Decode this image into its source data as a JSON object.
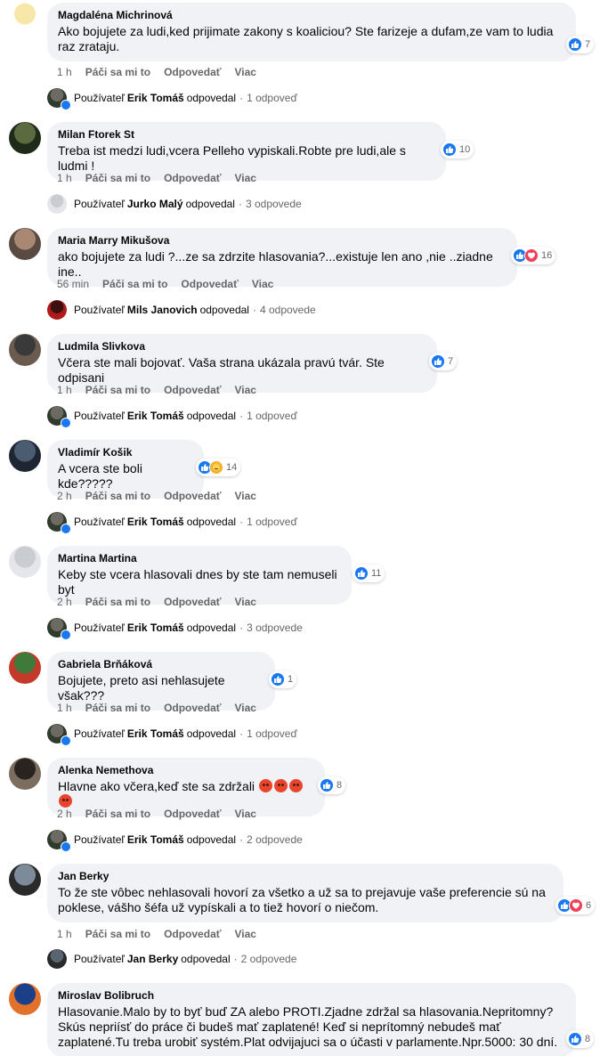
{
  "labels": {
    "like": "Páči sa mi to",
    "reply": "Odpovedať",
    "more": "Viac",
    "user_prefix": "Používateľ",
    "replied": "odpovedal"
  },
  "colors": {
    "like": "#1877f2",
    "love": "#f33e58",
    "care": "#f7b125",
    "angry": "#e8452c"
  },
  "comments": [
    {
      "author": "Magdaléna Michrinová",
      "text": "Ako bojujete za ludi,ked prijimate zakony s koaliciou? Ste farizeje a dufam,ze vam to ludia raz zrataju.",
      "time": "1 h",
      "reactions": [
        "like"
      ],
      "reaction_count": "7",
      "reply_user": "Erik Tomáš",
      "reply_count": "1 odpoveď"
    },
    {
      "author": "Milan Ftorek St",
      "text": "Treba ist medzi ludi,vcera Pelleho vypiskali.Robte pre ludi,ale s ludmi !",
      "time": "1 h",
      "reactions": [
        "like"
      ],
      "reaction_count": "10",
      "reply_user": "Jurko Malý",
      "reply_count": "3 odpovede"
    },
    {
      "author": "Maria Marry Mikušova",
      "text": "ako bojujete za ludi ?...ze sa zdrzite hlasovania?...existuje len ano ,nie ..ziadne ine..",
      "time": "56 min",
      "reactions": [
        "like",
        "love"
      ],
      "reaction_count": "16",
      "reply_user": "Mils Janovich",
      "reply_count": "4 odpovede"
    },
    {
      "author": "Ludmila Slivkova",
      "text": "Včera ste mali bojovať. Vaša strana ukázala pravú tvár. Ste odpisani",
      "time": "1 h",
      "reactions": [
        "like"
      ],
      "reaction_count": "7",
      "reply_user": "Erik Tomáš",
      "reply_count": "1 odpoveď"
    },
    {
      "author": "Vladimír Košik",
      "text": "A vcera ste boli kde?????",
      "time": "2 h",
      "reactions": [
        "like",
        "care"
      ],
      "reaction_count": "14",
      "reply_user": "Erik Tomáš",
      "reply_count": "1 odpoveď"
    },
    {
      "author": "Martina Martina",
      "text": "Keby ste vcera hlasovali dnes by ste tam nemuseli byt",
      "time": "2 h",
      "reactions": [
        "like"
      ],
      "reaction_count": "11",
      "reply_user": "Erik Tomáš",
      "reply_count": "3 odpovede"
    },
    {
      "author": "Gabriela Brňáková",
      "text": "Bojujete, preto asi nehlasujete však???",
      "time": "1 h",
      "reactions": [
        "like"
      ],
      "reaction_count": "1",
      "reply_user": "Erik Tomáš",
      "reply_count": "1 odpoveď"
    },
    {
      "author": "Alenka Nemethova",
      "text": "Hlavne ako včera,keď ste sa zdržali",
      "time": "2 h",
      "reactions": [
        "like"
      ],
      "reaction_count": "8",
      "reply_user": "Erik Tomáš",
      "reply_count": "2 odpovede"
    },
    {
      "author": "Jan Berky",
      "text": "To že ste vôbec nehlasovali hovorí za všetko a už sa to prejavuje vaše preferencie sú na poklese, vášho šéfa už vypískali a to tiež hovorí o niečom.",
      "time": "1 h",
      "reactions": [
        "like",
        "love"
      ],
      "reaction_count": "6",
      "reply_user": "Jan Berky",
      "reply_count": "2 odpovede"
    },
    {
      "author": "Miroslav Bolibruch",
      "text": "Hlasovanie.Malo by to byť buď ZA alebo PROTI.Zjadne zdržal sa hlasovania.Nepritomny? Skús nepriísť do práce či budeš mať zaplatené! Keď si neprítomný nebudeš mať zaplatené.Tu treba urobiť systém.Plat odvijajuci sa o účasti v parlamente.Npr.5000: 30 dní.",
      "reactions": [
        "like"
      ],
      "reaction_count": "8"
    }
  ]
}
